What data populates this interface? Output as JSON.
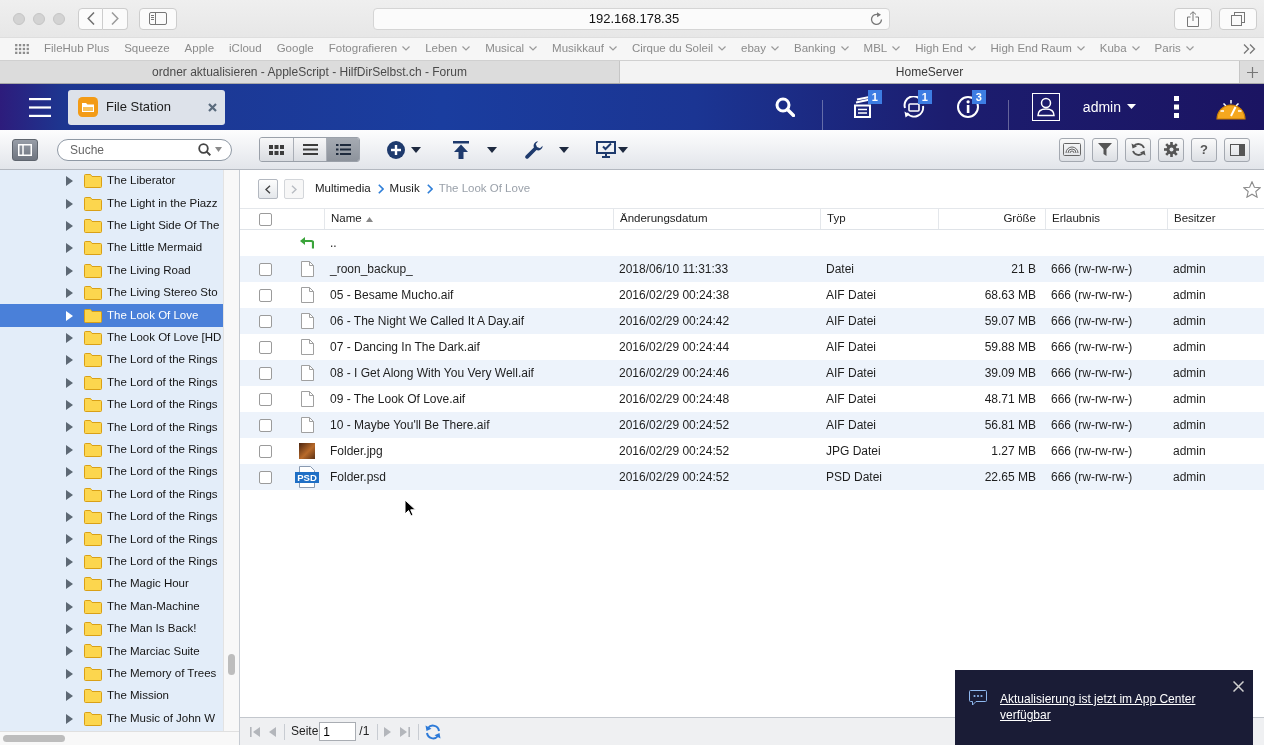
{
  "browser": {
    "address": "192.168.178.35",
    "bookmarks": [
      {
        "label": "FileHub Plus",
        "folder": false
      },
      {
        "label": "Squeeze",
        "folder": false
      },
      {
        "label": "Apple",
        "folder": false
      },
      {
        "label": "iCloud",
        "folder": false
      },
      {
        "label": "Google",
        "folder": false
      },
      {
        "label": "Fotografieren",
        "folder": true
      },
      {
        "label": "Leben",
        "folder": true
      },
      {
        "label": "Musical",
        "folder": true
      },
      {
        "label": "Musikkauf",
        "folder": true
      },
      {
        "label": "Cirque du Soleil",
        "folder": true
      },
      {
        "label": "ebay",
        "folder": true
      },
      {
        "label": "Banking",
        "folder": true
      },
      {
        "label": "MBL",
        "folder": true
      },
      {
        "label": "High End",
        "folder": true
      },
      {
        "label": "High End Raum",
        "folder": true
      },
      {
        "label": "Kuba",
        "folder": true
      },
      {
        "label": "Paris",
        "folder": true
      }
    ],
    "tabs": [
      {
        "title": "ordner aktualisieren - AppleScript - HilfDirSelbst.ch - Forum",
        "selected": false
      },
      {
        "title": "HomeServer",
        "selected": true
      }
    ]
  },
  "app_header": {
    "app_tabs": [
      {
        "title": "File Station"
      }
    ],
    "notifications": [
      {
        "kind": "tasks",
        "badge": "1"
      },
      {
        "kind": "sync",
        "badge": "1"
      },
      {
        "kind": "info",
        "badge": "3"
      }
    ],
    "user": "admin"
  },
  "toolbar": {
    "search": {
      "placeholder": "Suche"
    },
    "views": [
      {
        "kind": "grid",
        "selected": false
      },
      {
        "kind": "list",
        "selected": false
      },
      {
        "kind": "details",
        "selected": true
      }
    ],
    "help_label": "?"
  },
  "tree": {
    "items": [
      {
        "label": "The Liberator",
        "selected": false,
        "expanded": false
      },
      {
        "label": "The Light in the Piazz",
        "selected": false,
        "expanded": false
      },
      {
        "label": "The Light Side Of The",
        "selected": false,
        "expanded": false
      },
      {
        "label": "The Little Mermaid",
        "selected": false,
        "expanded": false
      },
      {
        "label": "The Living Road",
        "selected": false,
        "expanded": false
      },
      {
        "label": "The Living Stereo Sto",
        "selected": false,
        "expanded": false
      },
      {
        "label": "The Look Of Love",
        "selected": true,
        "expanded": false
      },
      {
        "label": "The Look Of Love [HD",
        "selected": false,
        "expanded": false
      },
      {
        "label": "The Lord of the Rings",
        "selected": false,
        "expanded": false
      },
      {
        "label": "The Lord of the Rings",
        "selected": false,
        "expanded": false
      },
      {
        "label": "The Lord of the Rings",
        "selected": false,
        "expanded": false
      },
      {
        "label": "The Lord of the Rings",
        "selected": false,
        "expanded": false
      },
      {
        "label": "The Lord of the Rings",
        "selected": false,
        "expanded": false
      },
      {
        "label": "The Lord of the Rings",
        "selected": false,
        "expanded": false
      },
      {
        "label": "The Lord of the Rings",
        "selected": false,
        "expanded": false
      },
      {
        "label": "The Lord of the Rings",
        "selected": false,
        "expanded": false
      },
      {
        "label": "The Lord of the Rings",
        "selected": false,
        "expanded": false
      },
      {
        "label": "The Lord of the Rings",
        "selected": false,
        "expanded": false
      },
      {
        "label": "The Magic Hour",
        "selected": false,
        "expanded": false
      },
      {
        "label": "The Man-Machine",
        "selected": false,
        "expanded": false
      },
      {
        "label": "The Man Is Back!",
        "selected": false,
        "expanded": false
      },
      {
        "label": "The Marciac Suite",
        "selected": false,
        "expanded": false
      },
      {
        "label": "The Memory of Trees",
        "selected": false,
        "expanded": false
      },
      {
        "label": "The Mission",
        "selected": false,
        "expanded": false
      },
      {
        "label": "The Music of John W",
        "selected": false,
        "expanded": false
      }
    ]
  },
  "breadcrumb": {
    "buttons": [
      {
        "kind": "back",
        "disabled": false
      },
      {
        "kind": "forward",
        "disabled": true
      }
    ],
    "path": [
      {
        "label": "Multimedia",
        "current": false
      },
      {
        "label": "Musik",
        "current": false
      },
      {
        "label": "The Look Of Love",
        "current": true
      }
    ]
  },
  "table": {
    "select_all": {
      "checked": false
    },
    "columns": [
      {
        "label": "Name",
        "sorted": true
      },
      {
        "label": "Änderungsdatum",
        "sorted": false
      },
      {
        "label": "Typ",
        "sorted": false
      },
      {
        "label": "Größe",
        "sorted": false
      },
      {
        "label": "Erlaubnis",
        "sorted": false
      },
      {
        "label": "Besitzer",
        "sorted": false
      }
    ],
    "rows": [
      {
        "kind": "parent",
        "cells": [
          ".."
        ]
      },
      {
        "kind": "file",
        "checked": false,
        "cells": [
          "_roon_backup_",
          "2018/06/10 11:31:33",
          "Datei",
          "21 B",
          "666 (rw-rw-rw-)",
          "admin"
        ]
      },
      {
        "kind": "file",
        "checked": false,
        "cells": [
          "05 - Besame Mucho.aif",
          "2016/02/29 00:24:38",
          "AIF Datei",
          "68.63 MB",
          "666 (rw-rw-rw-)",
          "admin"
        ]
      },
      {
        "kind": "file",
        "checked": false,
        "cells": [
          "06 - The Night We Called It A Day.aif",
          "2016/02/29 00:24:42",
          "AIF Datei",
          "59.07 MB",
          "666 (rw-rw-rw-)",
          "admin"
        ]
      },
      {
        "kind": "file",
        "checked": false,
        "cells": [
          "07 - Dancing In The Dark.aif",
          "2016/02/29 00:24:44",
          "AIF Datei",
          "59.88 MB",
          "666 (rw-rw-rw-)",
          "admin"
        ]
      },
      {
        "kind": "file",
        "checked": false,
        "cells": [
          "08 - I Get Along With You Very Well.aif",
          "2016/02/29 00:24:46",
          "AIF Datei",
          "39.09 MB",
          "666 (rw-rw-rw-)",
          "admin"
        ]
      },
      {
        "kind": "file",
        "checked": false,
        "cells": [
          "09 - The Look Of Love.aif",
          "2016/02/29 00:24:48",
          "AIF Datei",
          "48.71 MB",
          "666 (rw-rw-rw-)",
          "admin"
        ]
      },
      {
        "kind": "file",
        "checked": false,
        "cells": [
          "10 - Maybe You'll Be There.aif",
          "2016/02/29 00:24:52",
          "AIF Datei",
          "56.81 MB",
          "666 (rw-rw-rw-)",
          "admin"
        ]
      },
      {
        "kind": "image",
        "checked": false,
        "cells": [
          "Folder.jpg",
          "2016/02/29 00:24:52",
          "JPG Datei",
          "1.27 MB",
          "666 (rw-rw-rw-)",
          "admin"
        ]
      },
      {
        "kind": "psd",
        "checked": false,
        "icon_label": "PSD",
        "cells": [
          "Folder.psd",
          "2016/02/29 00:24:52",
          "PSD Datei",
          "22.65 MB",
          "666 (rw-rw-rw-)",
          "admin"
        ]
      }
    ]
  },
  "pager": {
    "buttons": [
      {
        "kind": "first",
        "disabled": true
      },
      {
        "kind": "prev",
        "disabled": true
      },
      {
        "kind": "next",
        "disabled": true
      },
      {
        "kind": "last",
        "disabled": true
      }
    ],
    "page_label": "Seite",
    "page": "1",
    "page_total": "/1"
  },
  "toast": {
    "message": "Aktualisierung ist jetzt im App Center verfügbar"
  }
}
